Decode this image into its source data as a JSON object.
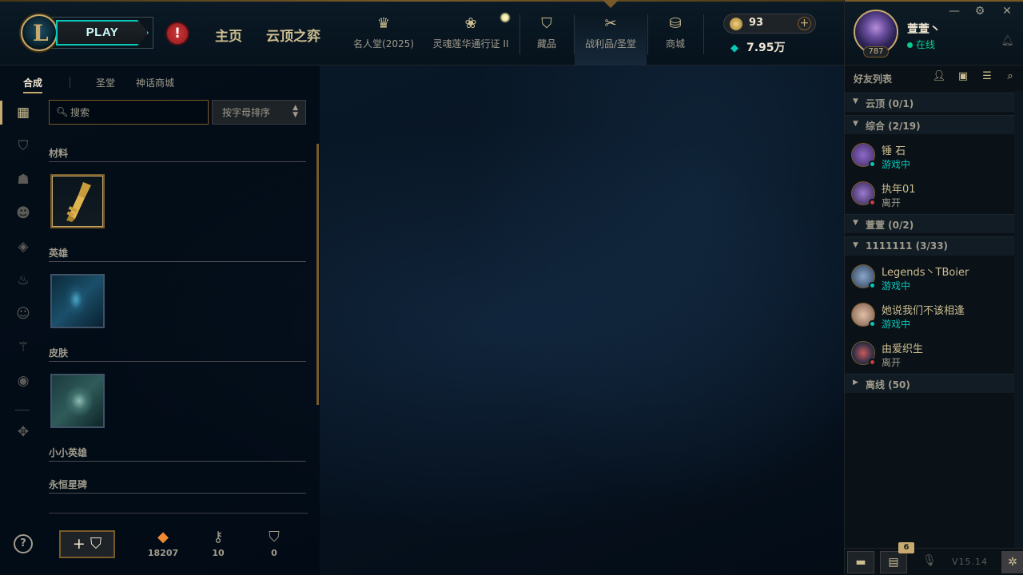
{
  "topbar": {
    "play_label": "PLAY",
    "alert_glyph": "!",
    "nav_main": [
      "主页",
      "云顶之弈"
    ],
    "nav_items": [
      {
        "label": "名人堂(2025)",
        "icon": "hall-of-fame-icon"
      },
      {
        "label": "灵魂莲华通行证 II",
        "icon": "spirit-blossom-pass-icon"
      },
      {
        "label": "藏品",
        "icon": "collection-icon"
      },
      {
        "label": "战利品/圣堂",
        "icon": "loot-icon"
      },
      {
        "label": "商城",
        "icon": "store-icon"
      }
    ],
    "rp": "93",
    "be": "7.95万"
  },
  "profile": {
    "name": "萱萱丶",
    "status": "在线",
    "level": "787"
  },
  "loot": {
    "tabs": [
      "合成",
      "圣堂",
      "神话商城"
    ],
    "search_placeholder": "搜索",
    "sort_label": "按字母排序",
    "categories": [
      "材料",
      "英雄",
      "皮肤",
      "小小英雄",
      "永恒星碑"
    ],
    "currencies": [
      {
        "icon": "orange-essence-icon",
        "value": "18207"
      },
      {
        "icon": "key-icon",
        "value": "10"
      },
      {
        "icon": "chest-icon",
        "value": "0"
      }
    ],
    "craft_label": "+ ⛉",
    "help_label": "?"
  },
  "friends": {
    "title": "好友列表",
    "groups": [
      {
        "label": "云顶 (0/1)",
        "expanded": true
      },
      {
        "label": "综合 (2/19)",
        "expanded": true
      },
      {
        "label": "萱萱 (0/2)",
        "expanded": true
      },
      {
        "label": "1111111 (3/33)",
        "expanded": true
      },
      {
        "label": "离线 (50)",
        "expanded": false
      }
    ],
    "list": [
      {
        "name": "锤 石",
        "status": "游戏中",
        "state": "ingame",
        "color": "#5a3f8c"
      },
      {
        "name": "执年01",
        "status": "离开",
        "state": "away",
        "color": "#4b3a6e"
      },
      {
        "name": "Legends丶TBoier",
        "status": "游戏中",
        "state": "ingame",
        "color": "#3c5a7a"
      },
      {
        "name": "她说我们不该相逢",
        "status": "游戏中",
        "state": "ingame",
        "color": "#8a6a58"
      },
      {
        "name": "由爱织生",
        "status": "离开",
        "state": "away",
        "color": "#2f3f5e"
      }
    ],
    "notification_count": "6",
    "version": "V15.14"
  },
  "colors": {
    "gold": "#c8aa6e",
    "teal": "#0ac8b9",
    "online": "#0acb8f",
    "away": "#c6403a",
    "orange_essence": "#f08b32"
  }
}
